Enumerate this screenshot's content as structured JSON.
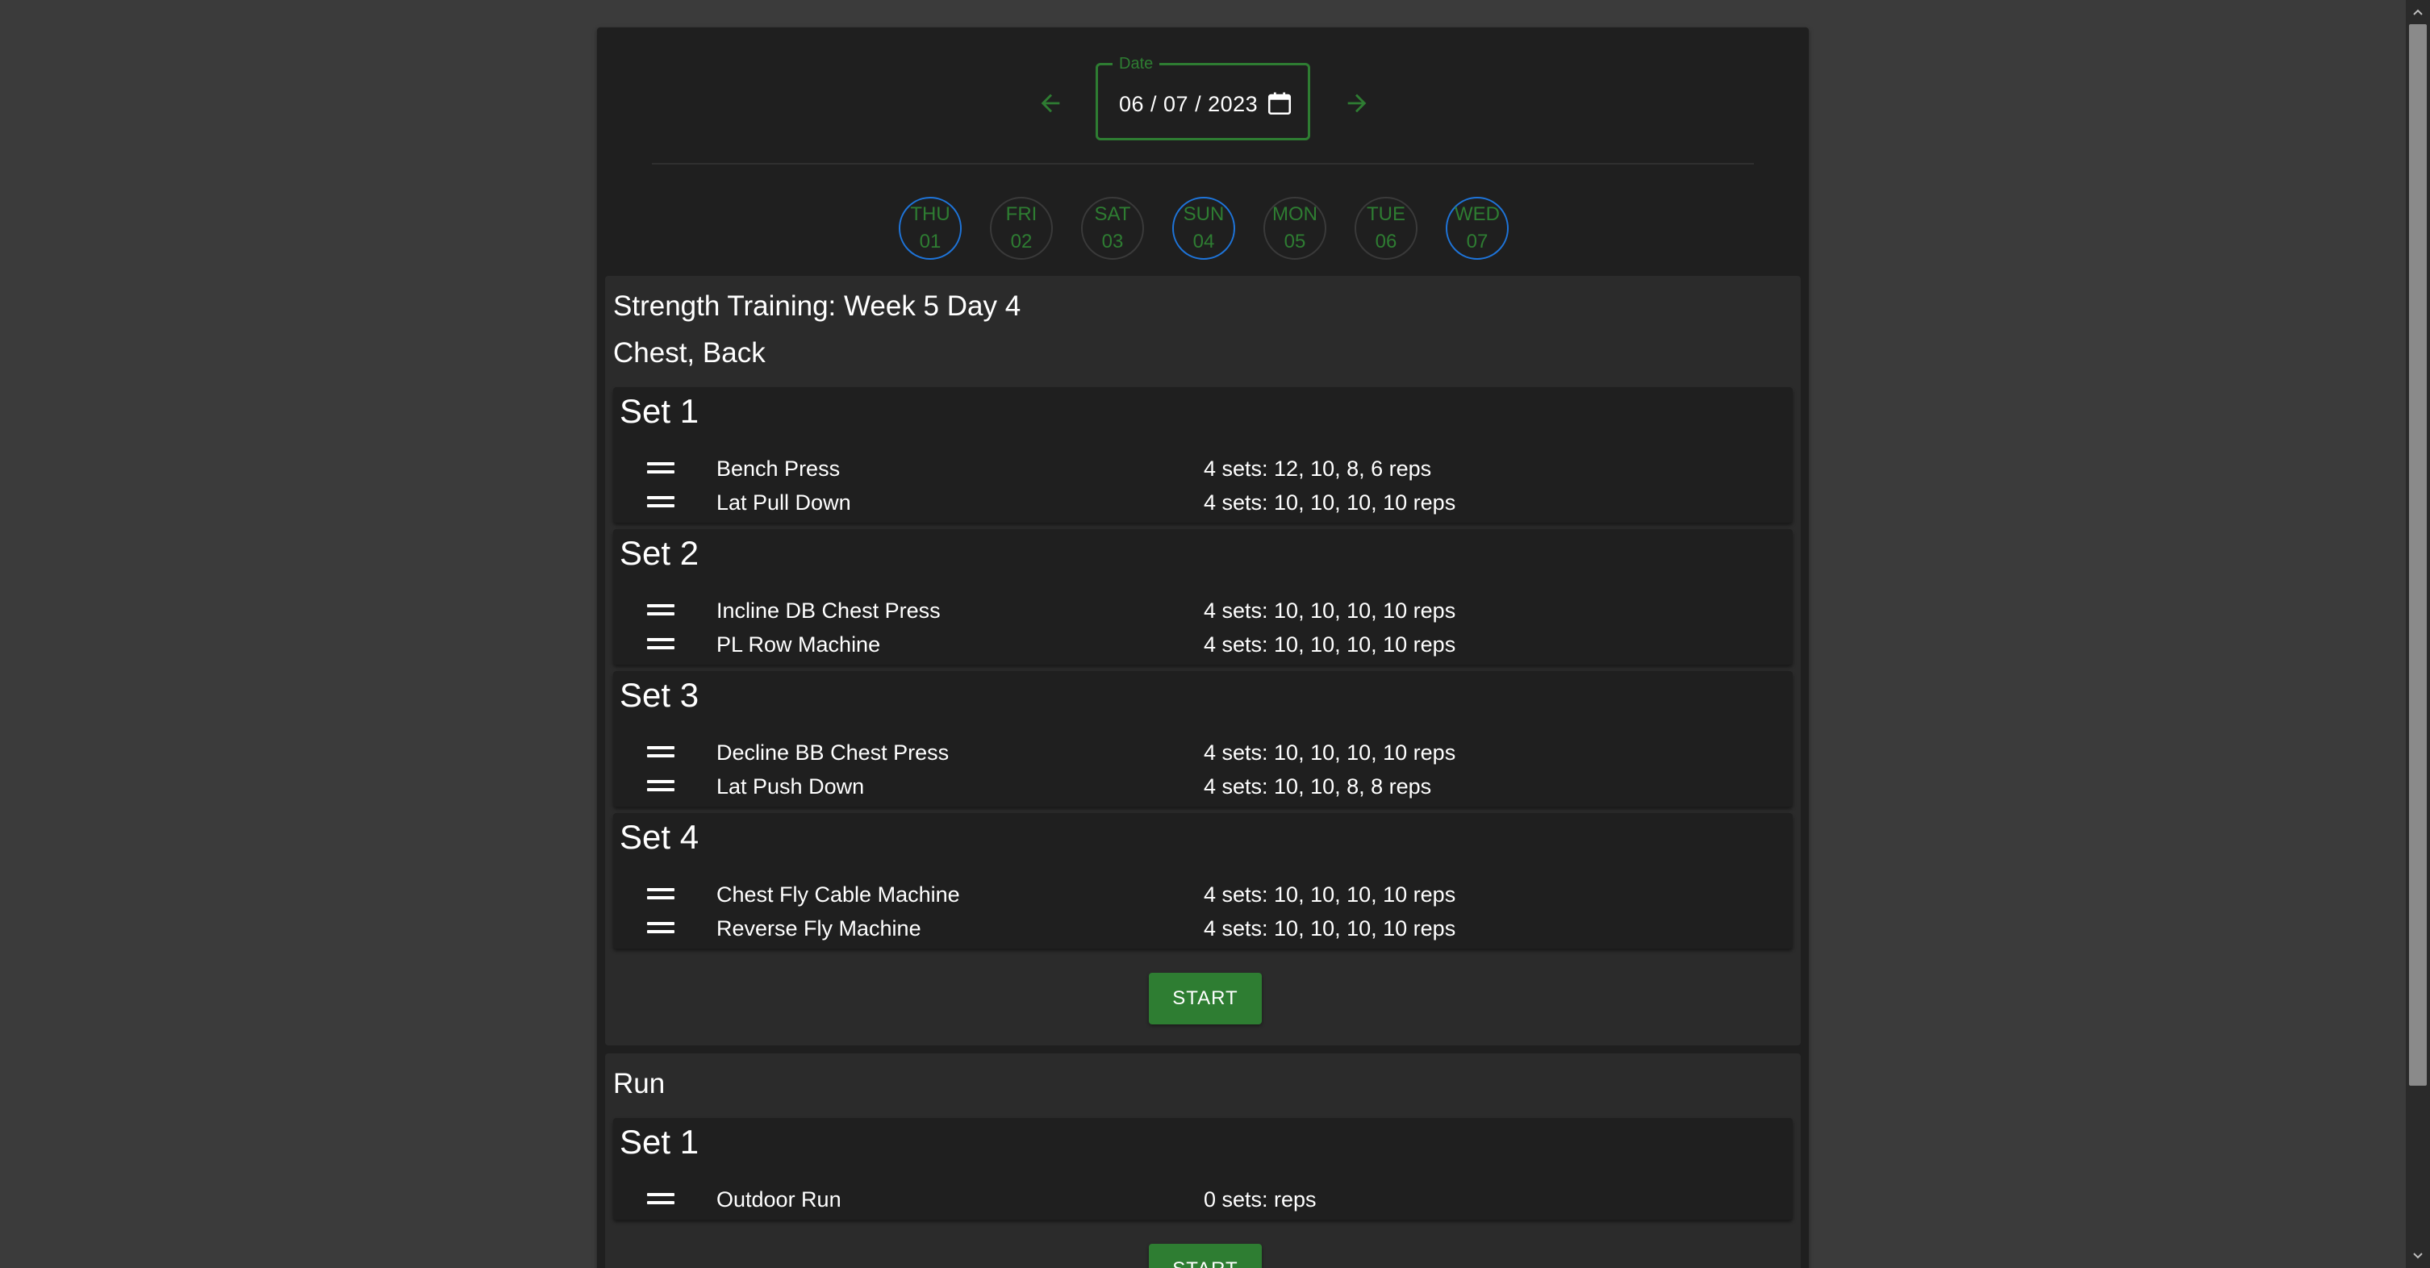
{
  "header": {
    "date_label": "Date",
    "date_value": "06 / 07 / 2023",
    "prev_icon": "arrow-left-icon",
    "next_icon": "arrow-right-icon",
    "calendar_icon": "calendar-icon"
  },
  "week": [
    {
      "name": "THU",
      "date": "01",
      "active": true
    },
    {
      "name": "FRI",
      "date": "02",
      "active": false
    },
    {
      "name": "SAT",
      "date": "03",
      "active": false
    },
    {
      "name": "SUN",
      "date": "04",
      "active": true
    },
    {
      "name": "MON",
      "date": "05",
      "active": false
    },
    {
      "name": "TUE",
      "date": "06",
      "active": false
    },
    {
      "name": "WED",
      "date": "07",
      "active": true
    }
  ],
  "workouts": [
    {
      "title": "Strength Training: Week 5 Day 4",
      "subtitle": "Chest, Back",
      "start_label": "START",
      "sets": [
        {
          "title": "Set 1",
          "exercises": [
            {
              "name": "Bench Press",
              "sets": "4 sets: 12, 10, 8, 6 reps"
            },
            {
              "name": "Lat Pull Down",
              "sets": "4 sets: 10, 10, 10, 10 reps"
            }
          ]
        },
        {
          "title": "Set 2",
          "exercises": [
            {
              "name": "Incline DB Chest Press",
              "sets": "4 sets: 10, 10, 10, 10 reps"
            },
            {
              "name": "PL Row Machine",
              "sets": "4 sets: 10, 10, 10, 10 reps"
            }
          ]
        },
        {
          "title": "Set 3",
          "exercises": [
            {
              "name": "Decline BB Chest Press",
              "sets": "4 sets: 10, 10, 10, 10 reps"
            },
            {
              "name": "Lat Push Down",
              "sets": "4 sets: 10, 10, 8, 8 reps"
            }
          ]
        },
        {
          "title": "Set 4",
          "exercises": [
            {
              "name": "Chest Fly Cable Machine",
              "sets": "4 sets: 10, 10, 10, 10 reps"
            },
            {
              "name": "Reverse Fly Machine",
              "sets": "4 sets: 10, 10, 10, 10 reps"
            }
          ]
        }
      ]
    },
    {
      "title": "Run",
      "start_label": "START",
      "sets": [
        {
          "title": "Set 1",
          "exercises": [
            {
              "name": "Outdoor Run",
              "sets": "0 sets: reps"
            }
          ]
        }
      ]
    }
  ],
  "colors": {
    "accent": "#2e7d32",
    "active_ring": "#1e74d9",
    "page_bg": "#3b3b3b",
    "panel_bg": "#1f1f1f",
    "card_bg": "#2b2b2b"
  }
}
